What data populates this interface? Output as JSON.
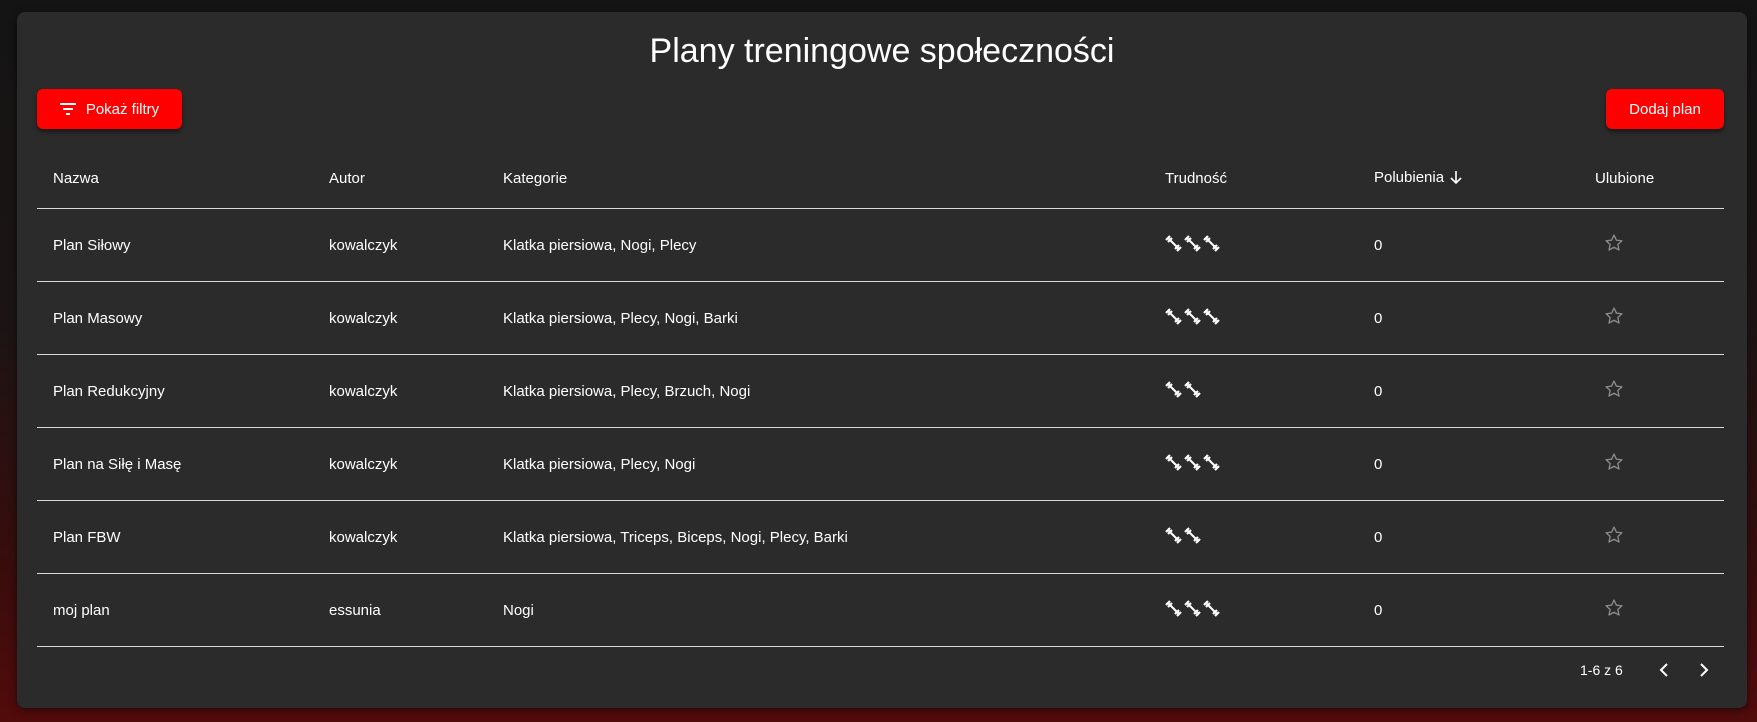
{
  "page": {
    "title": "Plany treningowe społeczności"
  },
  "toolbar": {
    "filter_label": "Pokaż filtry",
    "add_label": "Dodaj plan"
  },
  "colors": {
    "accent": "#ff0000",
    "card_bg": "#2b2b2b",
    "text": "#ffffff",
    "divider": "#d9d9d9",
    "star": "#8a8a8a"
  },
  "table": {
    "headers": {
      "name": "Nazwa",
      "author": "Autor",
      "categories": "Kategorie",
      "difficulty": "Trudność",
      "likes": "Polubienia",
      "favorites": "Ulubione"
    },
    "sort": {
      "column": "likes",
      "direction": "descending"
    },
    "rows": [
      {
        "name": "Plan Siłowy",
        "author": "kowalczyk",
        "categories": "Klatka piersiowa, Nogi, Plecy",
        "difficulty": 3,
        "likes": "0",
        "favorite": false
      },
      {
        "name": "Plan Masowy",
        "author": "kowalczyk",
        "categories": "Klatka piersiowa, Plecy, Nogi, Barki",
        "difficulty": 3,
        "likes": "0",
        "favorite": false
      },
      {
        "name": "Plan Redukcyjny",
        "author": "kowalczyk",
        "categories": "Klatka piersiowa, Plecy, Brzuch, Nogi",
        "difficulty": 2,
        "likes": "0",
        "favorite": false
      },
      {
        "name": "Plan na Siłę i Masę",
        "author": "kowalczyk",
        "categories": "Klatka piersiowa, Plecy, Nogi",
        "difficulty": 3,
        "likes": "0",
        "favorite": false
      },
      {
        "name": "Plan FBW",
        "author": "kowalczyk",
        "categories": "Klatka piersiowa, Triceps, Biceps, Nogi, Plecy, Barki",
        "difficulty": 2,
        "likes": "0",
        "favorite": false
      },
      {
        "name": "moj plan",
        "author": "essunia",
        "categories": "Nogi",
        "difficulty": 3,
        "likes": "0",
        "favorite": false
      }
    ]
  },
  "pagination": {
    "range_label": "1-6 z 6"
  },
  "icons": {
    "filter": "filter-list-icon",
    "sort": "arrow-down-icon",
    "difficulty": "fitness-dumbbell-icon",
    "favorite": "star-outline-icon",
    "prev": "chevron-left-icon",
    "next": "chevron-right-icon"
  }
}
